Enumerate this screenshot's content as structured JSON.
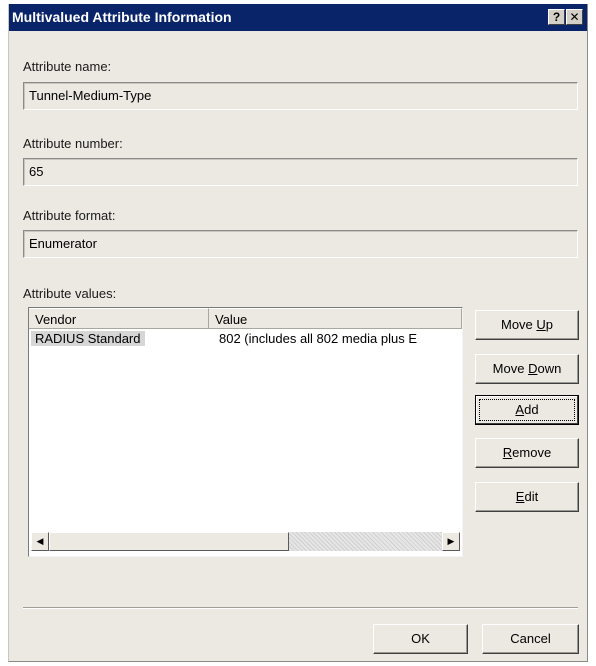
{
  "dialog": {
    "title": "Multivalued Attribute Information",
    "help_glyph": "?",
    "close_glyph": "✕"
  },
  "fields": {
    "name_label": "Attribute name:",
    "name_value": "Tunnel-Medium-Type",
    "number_label": "Attribute number:",
    "number_value": "65",
    "format_label": "Attribute format:",
    "format_value": "Enumerator"
  },
  "values": {
    "label": "Attribute values:",
    "columns": [
      "Vendor",
      "Value"
    ],
    "rows": [
      {
        "vendor": "RADIUS Standard",
        "value": "802 (includes all 802 media plus E"
      }
    ],
    "scroll_left": "◀",
    "scroll_right": "▶"
  },
  "buttons": {
    "move_up": {
      "pre": "Move ",
      "key": "U",
      "post": "p"
    },
    "move_down": {
      "pre": "Move ",
      "key": "D",
      "post": "own"
    },
    "add": {
      "pre": "",
      "key": "A",
      "post": "dd"
    },
    "remove": {
      "pre": "",
      "key": "R",
      "post": "emove"
    },
    "edit": {
      "pre": "",
      "key": "E",
      "post": "dit"
    },
    "ok": "OK",
    "cancel": "Cancel"
  },
  "colors": {
    "titlebar": "#0a246a",
    "dialog_bg": "#ece9e3"
  }
}
